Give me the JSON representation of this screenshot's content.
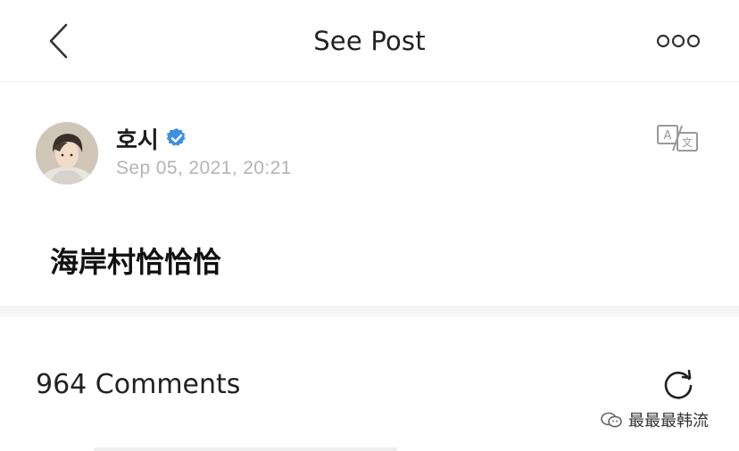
{
  "header": {
    "title": "See Post",
    "back_icon": "chevron-left-icon",
    "more_icon": "more-horizontal-icon"
  },
  "post": {
    "username": "호시",
    "verified_icon": "verified-badge-icon",
    "timestamp": "Sep 05, 2021, 20:21",
    "translate_icon": "translate-icon",
    "text": "海岸村恰恰恰"
  },
  "comments": {
    "count_label": "964 Comments",
    "refresh_icon": "refresh-icon"
  },
  "watermark": {
    "text": "最最最韩流",
    "icon": "wechat-channel-icon"
  },
  "colors": {
    "verified_blue": "#3d8fe0",
    "timestamp_gray": "#b4b4b4",
    "divider": "#f2f2f2"
  }
}
